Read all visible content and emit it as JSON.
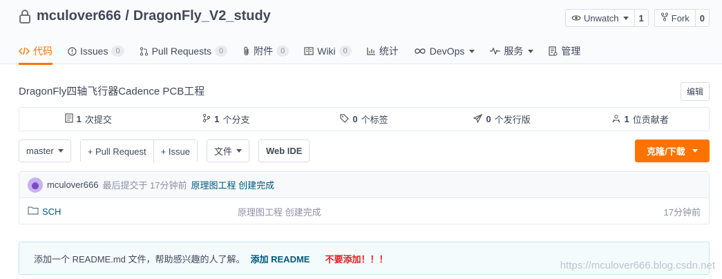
{
  "repo": {
    "owner": "mculover666",
    "separator": "/",
    "name": "DragonFly_V2_study"
  },
  "actions": {
    "watch": {
      "label": "Unwatch",
      "count": "1"
    },
    "fork": {
      "label": "Fork",
      "count": "0"
    }
  },
  "tabs": [
    {
      "label": "代码",
      "icon": "code-icon"
    },
    {
      "label": "Issues",
      "badge": "0",
      "icon": "issue-icon"
    },
    {
      "label": "Pull Requests",
      "badge": "0",
      "icon": "pull-request-icon"
    },
    {
      "label": "附件",
      "badge": "0",
      "icon": "paperclip-icon"
    },
    {
      "label": "Wiki",
      "badge": "0",
      "icon": "book-icon"
    },
    {
      "label": "统计",
      "icon": "bar-chart-icon"
    },
    {
      "label": "DevOps",
      "icon": "infinity-icon"
    },
    {
      "label": "服务",
      "icon": "pulse-icon"
    },
    {
      "label": "管理",
      "icon": "settings-doc-icon"
    }
  ],
  "description": "DragonFly四轴飞行器Cadence PCB工程",
  "edit_label": "编辑",
  "stats": [
    {
      "count": "1",
      "label": "次提交",
      "icon": "commit-doc-icon"
    },
    {
      "count": "1",
      "label": "个分支",
      "icon": "branch-icon"
    },
    {
      "count": "0",
      "label": "个标签",
      "icon": "tag-icon"
    },
    {
      "count": "0",
      "label": "个发行版",
      "icon": "send-icon"
    },
    {
      "count": "1",
      "label": "位贡献者",
      "icon": "contributors-icon"
    }
  ],
  "toolbar": {
    "branch": "master",
    "pull_request": "+ Pull Request",
    "issue": "+ Issue",
    "file": "文件",
    "web_ide": "Web IDE",
    "clone": "克隆/下载"
  },
  "last_commit": {
    "author": "mculover666",
    "meta": "最后提交于 17分钟前",
    "message": "原理图工程 创建完成"
  },
  "files": [
    {
      "name": "SCH",
      "message": "原理图工程 创建完成",
      "time": "17分钟前",
      "icon": "folder-icon"
    }
  ],
  "readme": {
    "text": "添加一个 README.md 文件，帮助感兴趣的人了解。",
    "add_label": "添加 README",
    "warning": "不要添加！！！"
  },
  "watermark": "https://mculover666.blog.csdn.net",
  "colors": {
    "accent": "#fe7300",
    "link": "#005980",
    "warning": "#e02020"
  }
}
